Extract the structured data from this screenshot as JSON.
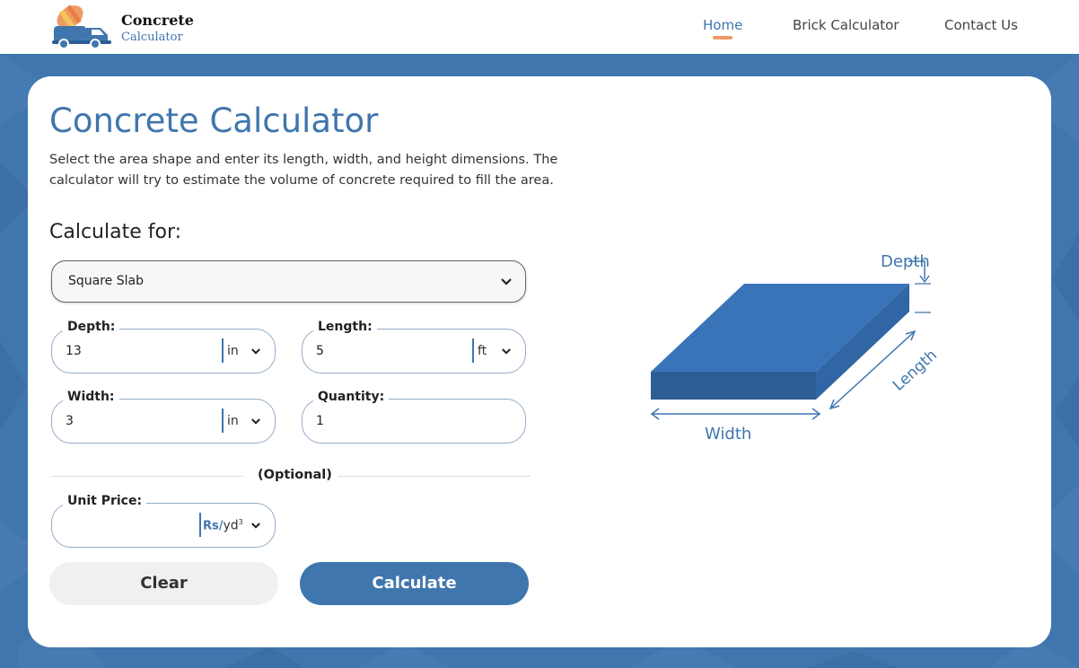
{
  "header": {
    "logo": {
      "title": "Concrete",
      "subtitle": "Calculator",
      "icon": "concrete-mixer-truck-icon"
    },
    "nav": [
      {
        "label": "Home",
        "active": true
      },
      {
        "label": "Brick Calculator",
        "active": false
      },
      {
        "label": "Contact Us",
        "active": false
      }
    ]
  },
  "main": {
    "title": "Concrete Calculator",
    "description": "Select the area shape and enter its length, width, and height dimensions. The calculator will try to estimate the volume of concrete required to fill the area.",
    "calculate_for_label": "Calculate for:",
    "shape_select": {
      "value": "Square Slab"
    },
    "fields": {
      "depth": {
        "label": "Depth:",
        "value": "13",
        "unit": "in"
      },
      "length": {
        "label": "Length:",
        "value": "5",
        "unit": "ft"
      },
      "width": {
        "label": "Width:",
        "value": "3",
        "unit": "in"
      },
      "quantity": {
        "label": "Quantity:",
        "value": "1"
      }
    },
    "optional_label": "(Optional)",
    "unit_price": {
      "label": "Unit Price:",
      "value": "",
      "currency": "Rs/",
      "unit": "yd",
      "unit_power": "3"
    },
    "buttons": {
      "clear": "Clear",
      "calculate": "Calculate"
    },
    "diagram": {
      "labels": {
        "depth": "Depth",
        "length": "Length",
        "width": "Width"
      }
    }
  },
  "colors": {
    "brand_blue": "#3f76ad",
    "accent_orange": "#ee9a66",
    "slab_top": "#3a74b8",
    "slab_side": "#2c5d95"
  }
}
